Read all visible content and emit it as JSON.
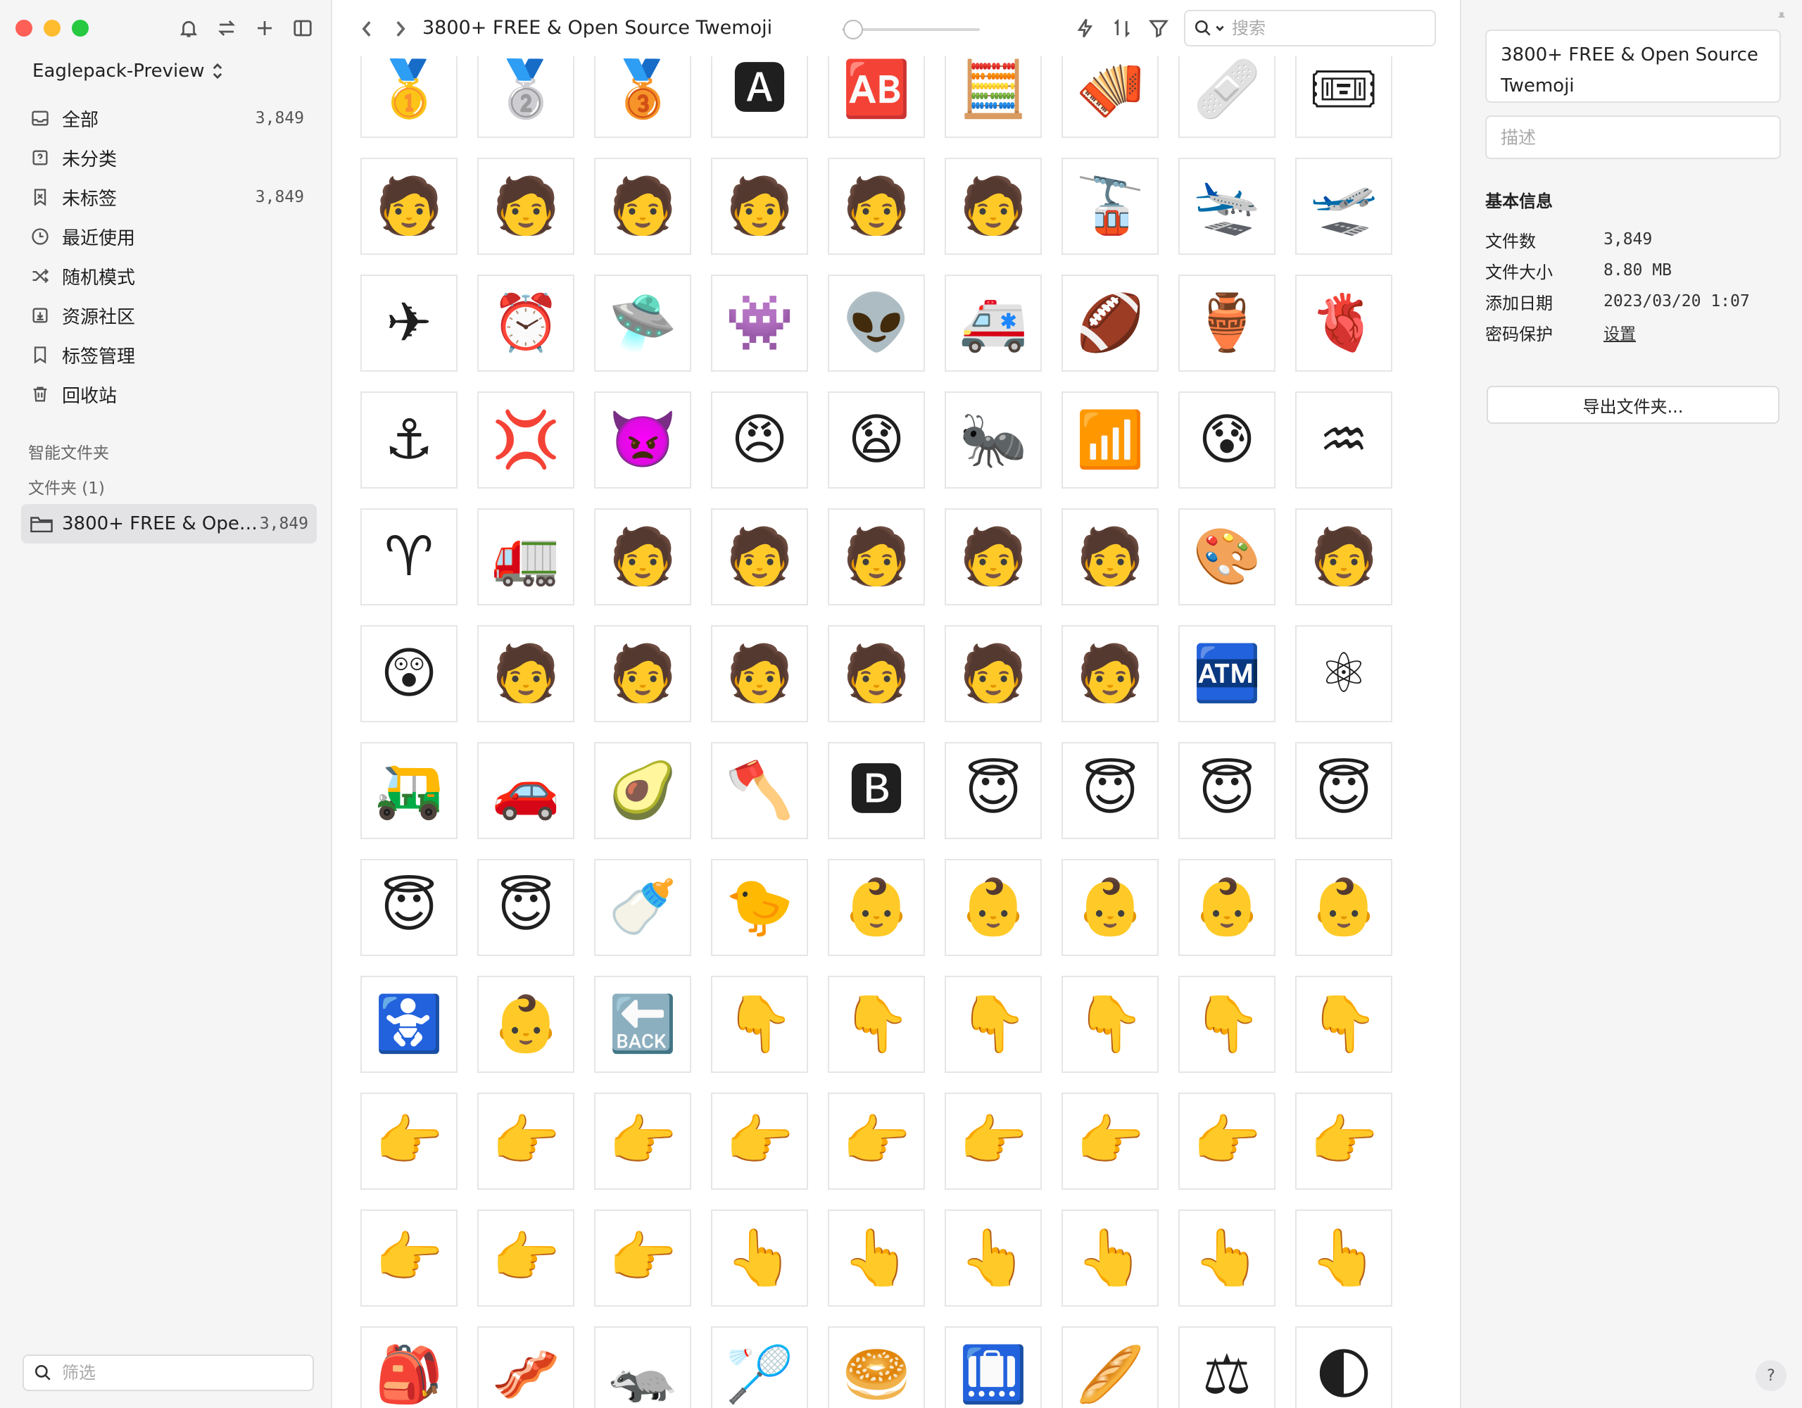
{
  "sidebar": {
    "library_name": "Eaglepack-Preview",
    "items": [
      {
        "label": "全部",
        "count": "3,849",
        "icon": "inbox-icon"
      },
      {
        "label": "未分类",
        "count": "",
        "icon": "question-box-icon"
      },
      {
        "label": "未标签",
        "count": "3,849",
        "icon": "untagged-icon"
      },
      {
        "label": "最近使用",
        "count": "",
        "icon": "clock-icon"
      },
      {
        "label": "随机模式",
        "count": "",
        "icon": "shuffle-icon"
      },
      {
        "label": "资源社区",
        "count": "",
        "icon": "download-box-icon"
      },
      {
        "label": "标签管理",
        "count": "",
        "icon": "bookmark-icon"
      },
      {
        "label": "回收站",
        "count": "",
        "icon": "trash-icon"
      }
    ],
    "smart_folders_label": "智能文件夹",
    "folders_label": "文件夹 (1)",
    "folder": {
      "label": "3800+ FREE & Open Source Twemoji",
      "count": "3,849"
    },
    "filter_placeholder": "筛选"
  },
  "toolbar": {
    "title": "3800+ FREE & Open Source Twemoji",
    "search_placeholder": "搜索",
    "zoom_fraction": 0.02
  },
  "grid": {
    "emojis": [
      "🥇",
      "🥈",
      "🥉",
      "🅰",
      "🆎",
      "🧮",
      "🪗",
      "🩹",
      "🎟",
      "🧑",
      "🧑",
      "🧑",
      "🧑",
      "🧑",
      "🧑",
      "🚡",
      "🛬",
      "🛫",
      "✈",
      "⏰",
      "🛸",
      "👾",
      "👽",
      "🚑",
      "🏈",
      "🏺",
      "🫀",
      "⚓",
      "💢",
      "👿",
      "😠",
      "😧",
      "🐜",
      "📶",
      "😰",
      "♒",
      "♈",
      "🚛",
      "🧑",
      "🧑",
      "🧑",
      "🧑",
      "🧑",
      "🎨",
      "🧑",
      "😲",
      "🧑",
      "🧑",
      "🧑",
      "🧑",
      "🧑",
      "🧑",
      "🏧",
      "⚛",
      "🛺",
      "🚗",
      "🥑",
      "🪓",
      "🅱",
      "😇",
      "😇",
      "😇",
      "😇",
      "😇",
      "😇",
      "🍼",
      "🐤",
      "👶",
      "👶",
      "👶",
      "👶",
      "👶",
      "🚼",
      "👶",
      "🔙",
      "👇",
      "👇",
      "👇",
      "👇",
      "👇",
      "👇",
      "👉",
      "👉",
      "👉",
      "👉",
      "👉",
      "👉",
      "👉",
      "👉",
      "👉",
      "👉",
      "👉",
      "👉",
      "👆",
      "👆",
      "👆",
      "👆",
      "👆",
      "👆",
      "🎒",
      "🥓",
      "🦡",
      "🏸",
      "🥯",
      "🛄",
      "🥖",
      "⚖",
      "🌓"
    ]
  },
  "panel": {
    "name": "3800+ FREE & Open Source Twemoji",
    "description_placeholder": "描述",
    "info_title": "基本信息",
    "info": [
      {
        "key": "文件数",
        "value": "3,849"
      },
      {
        "key": "文件大小",
        "value": "8.80 MB"
      },
      {
        "key": "添加日期",
        "value": "2023/03/20 1:07"
      },
      {
        "key": "密码保护",
        "value": "设置"
      }
    ],
    "export_label": "导出文件夹...",
    "help_label": "?"
  }
}
